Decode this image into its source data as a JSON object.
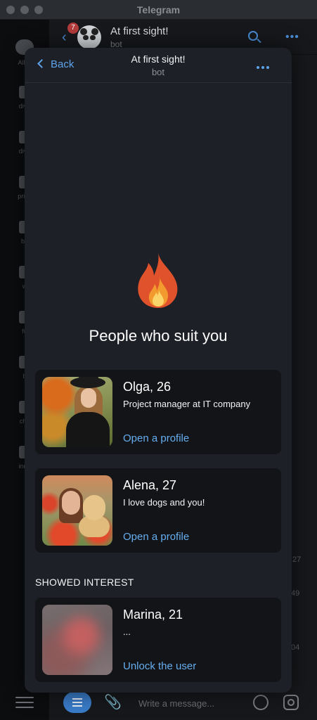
{
  "window": {
    "title": "Telegram"
  },
  "sidebar": {
    "items": [
      {
        "label": "All C",
        "icon": "chat-bubbles-icon"
      },
      {
        "label": "dive",
        "icon": "folder-icon"
      },
      {
        "label": "dive",
        "icon": "folder-icon"
      },
      {
        "label": "priva",
        "icon": "folder-icon"
      },
      {
        "label": "bo",
        "icon": "folder-icon"
      },
      {
        "label": "w",
        "icon": "folder-icon"
      },
      {
        "label": "fu",
        "icon": "folder-icon"
      },
      {
        "label": "b",
        "icon": "folder-icon"
      },
      {
        "label": "cha",
        "icon": "folder-icon"
      },
      {
        "label": "inno",
        "icon": "folder-icon"
      }
    ]
  },
  "chat": {
    "title": "At first sight!",
    "subtitle": "bot",
    "unread_badge": "7",
    "times": [
      "27",
      "49",
      "04"
    ],
    "composer_placeholder": "Write a message..."
  },
  "miniapp": {
    "back_label": "Back",
    "title": "At first sight!",
    "subtitle": "bot",
    "headline": "People who suit you",
    "profiles": [
      {
        "name": "Olga, 26",
        "desc": "Project manager at IT company",
        "link": "Open a profile"
      },
      {
        "name": "Alena, 27",
        "desc": "I love dogs and you!",
        "link": "Open a profile"
      }
    ],
    "section_title": "SHOWED INTEREST",
    "interest": {
      "name": "Marina, 21",
      "desc": "...",
      "link": "Unlock the user"
    }
  },
  "colors": {
    "accent": "#5ea4ec",
    "modal_bg": "#1d2027",
    "card_bg": "#121418",
    "badge": "#b23b3b"
  }
}
